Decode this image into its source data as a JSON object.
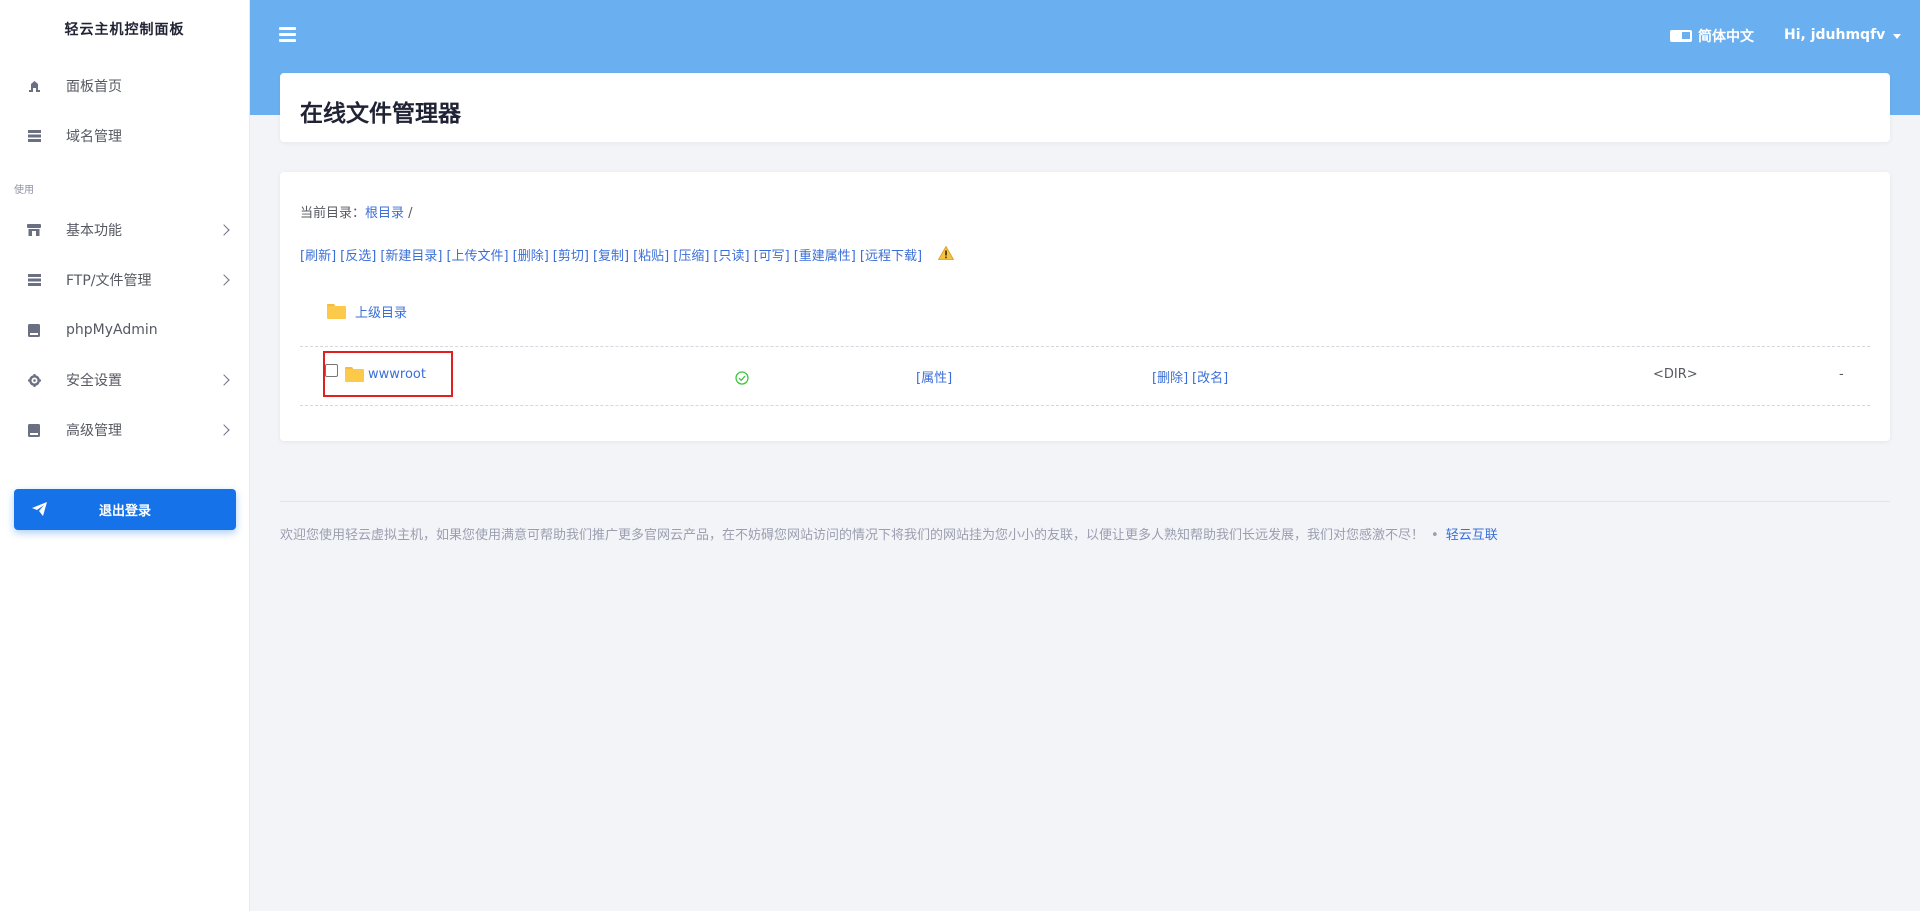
{
  "sidebar": {
    "brand": "轻云主机控制面板",
    "section_label": "使用",
    "items": [
      {
        "label": "面板首页",
        "icon": "dashboard-icon"
      },
      {
        "label": "域名管理",
        "icon": "server-icon"
      },
      {
        "label": "基本功能",
        "icon": "store-icon",
        "has_submenu": true
      },
      {
        "label": "FTP/文件管理",
        "icon": "server-icon",
        "has_submenu": true
      },
      {
        "label": "phpMyAdmin",
        "icon": "book-icon"
      },
      {
        "label": "安全设置",
        "icon": "gear-icon",
        "has_submenu": true
      },
      {
        "label": "高级管理",
        "icon": "book-icon",
        "has_submenu": true
      }
    ],
    "logout_label": "退出登录"
  },
  "header": {
    "language": "简体中文",
    "user_greeting": "Hi, jduhmqfv"
  },
  "page": {
    "title": "在线文件管理器"
  },
  "file_manager": {
    "current_dir_label": "当前目录：",
    "root_link": "根目录",
    "path_sep": " /",
    "actions": [
      "[刷新]",
      "[反选]",
      "[新建目录]",
      "[上传文件]",
      "[删除]",
      "[剪切]",
      "[复制]",
      "[粘贴]",
      "[压缩]",
      "[只读]",
      "[可写]",
      "[重建属性]",
      "[远程下载]"
    ],
    "parent_dir_label": "上级目录",
    "files": [
      {
        "name": "wwwroot",
        "attr_link": "[属性]",
        "delete_link": "[删除]",
        "rename_link": "[改名]",
        "type": "<DIR>",
        "size": "-"
      }
    ]
  },
  "footer": {
    "text": "欢迎您使用轻云虚拟主机，如果您使用满意可帮助我们推广更多官网云产品，在不妨碍您网站访问的情况下将我们的网站挂为您小小的友联，以便让更多人熟知帮助我们长远发展，我们对您感激不尽！",
    "dot": "•",
    "link": "轻云互联"
  },
  "colors": {
    "header_bg": "#6ab0f1",
    "primary": "#1572e8",
    "link": "#3b6fd8",
    "highlight_box": "#e0201f"
  }
}
